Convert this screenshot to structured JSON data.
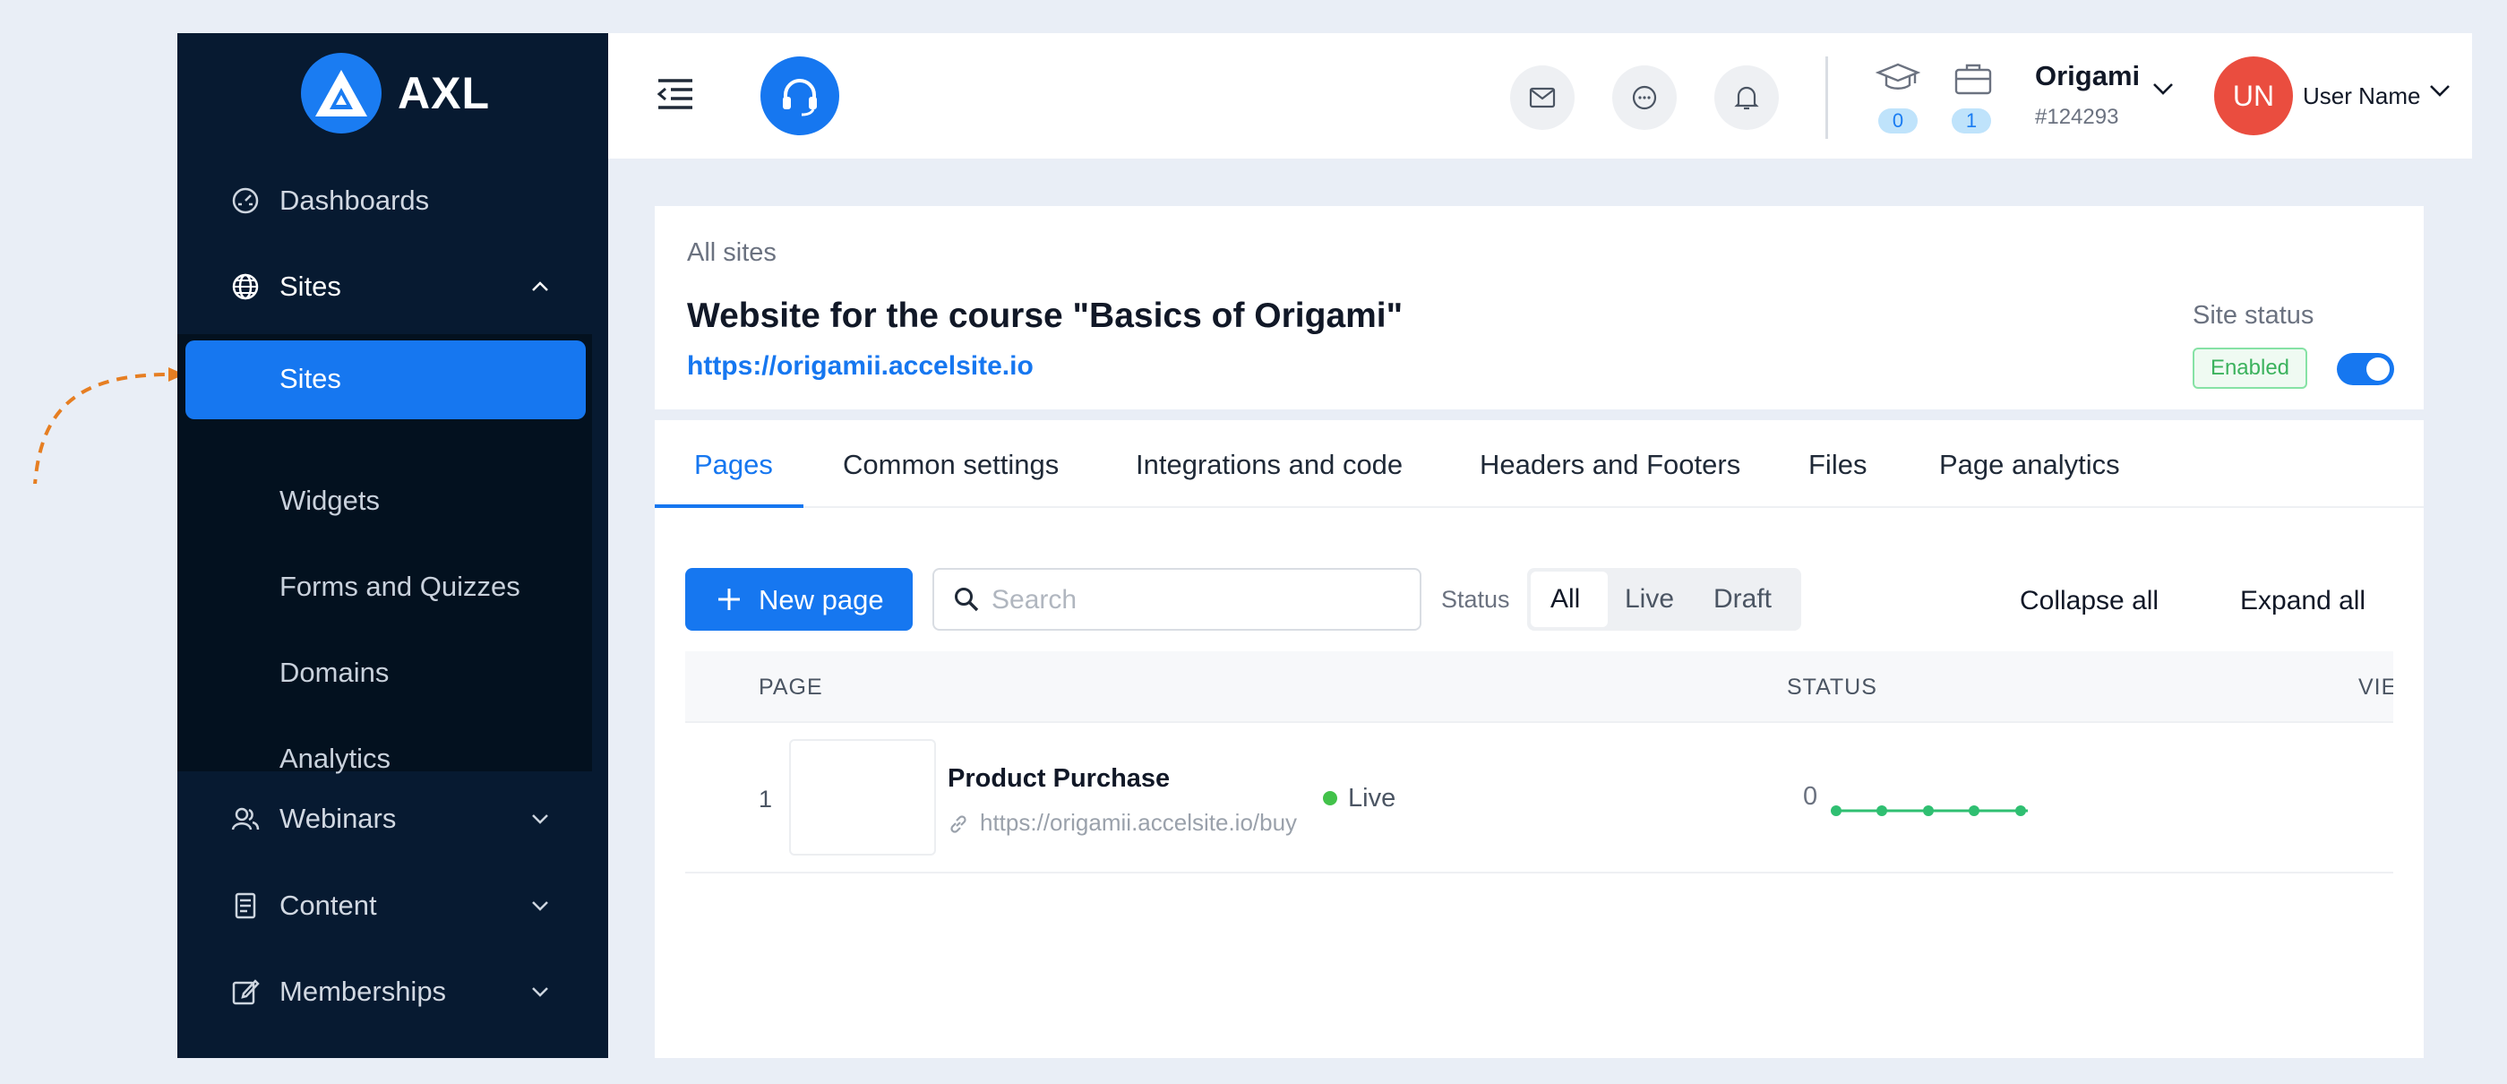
{
  "brand": {
    "name": "AXL",
    "accent": "#1677f0",
    "sidebar_bg": "#071a31"
  },
  "sidebar": {
    "items": [
      {
        "label": "Dashboards",
        "icon": "gauge-icon"
      },
      {
        "label": "Sites",
        "icon": "globe-icon",
        "expanded": true
      },
      {
        "label": "Webinars",
        "icon": "users-icon"
      },
      {
        "label": "Content",
        "icon": "book-icon"
      },
      {
        "label": "Memberships",
        "icon": "edit-icon"
      }
    ],
    "sub_items": [
      {
        "label": "Sites",
        "active": true
      },
      {
        "label": "Widgets"
      },
      {
        "label": "Forms and Quizzes"
      },
      {
        "label": "Domains"
      },
      {
        "label": "Analytics"
      }
    ]
  },
  "header": {
    "counters": [
      {
        "icon": "graduation-cap-icon",
        "value": "0"
      },
      {
        "icon": "briefcase-icon",
        "value": "1"
      }
    ],
    "org": {
      "name": "Origami",
      "id": "#124293"
    },
    "user": {
      "initials": "UN",
      "name": "User Name"
    }
  },
  "site": {
    "breadcrumb": "All sites",
    "title": "Website for the course \"Basics of Origami\"",
    "url": "https://origamii.accelsite.io",
    "status_label": "Site status",
    "status": "Enabled",
    "enabled": true
  },
  "tabs": [
    "Pages",
    "Common settings",
    "Integrations and code",
    "Headers and Footers",
    "Files",
    "Page analytics"
  ],
  "toolbar": {
    "new_page": "New page",
    "search_placeholder": "Search",
    "status_label": "Status",
    "filters": [
      "All",
      "Live",
      "Draft"
    ],
    "collapse": "Collapse all",
    "expand": "Expand all"
  },
  "table": {
    "columns": [
      "PAGE",
      "STATUS",
      "VIEWS"
    ],
    "rows": [
      {
        "num": "1",
        "name": "Product Purchase",
        "url": "https://origamii.accelsite.io/buy",
        "status": "Live",
        "views": "0"
      }
    ]
  }
}
